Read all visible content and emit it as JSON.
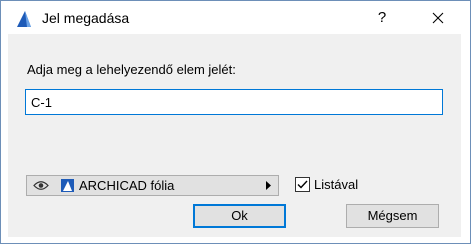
{
  "window": {
    "title": "Jel megadása",
    "help_label": "?"
  },
  "form": {
    "prompt": "Adja meg a lehelyezendő elem jelét:",
    "input_value": "C-1"
  },
  "layer": {
    "label": "ARCHICAD fólia"
  },
  "checkbox": {
    "label": "Listával",
    "checked": true
  },
  "buttons": {
    "ok": "Ok",
    "cancel": "Mégsem"
  },
  "colors": {
    "accent": "#0078d7",
    "app_icon": "#1e5bb8"
  }
}
